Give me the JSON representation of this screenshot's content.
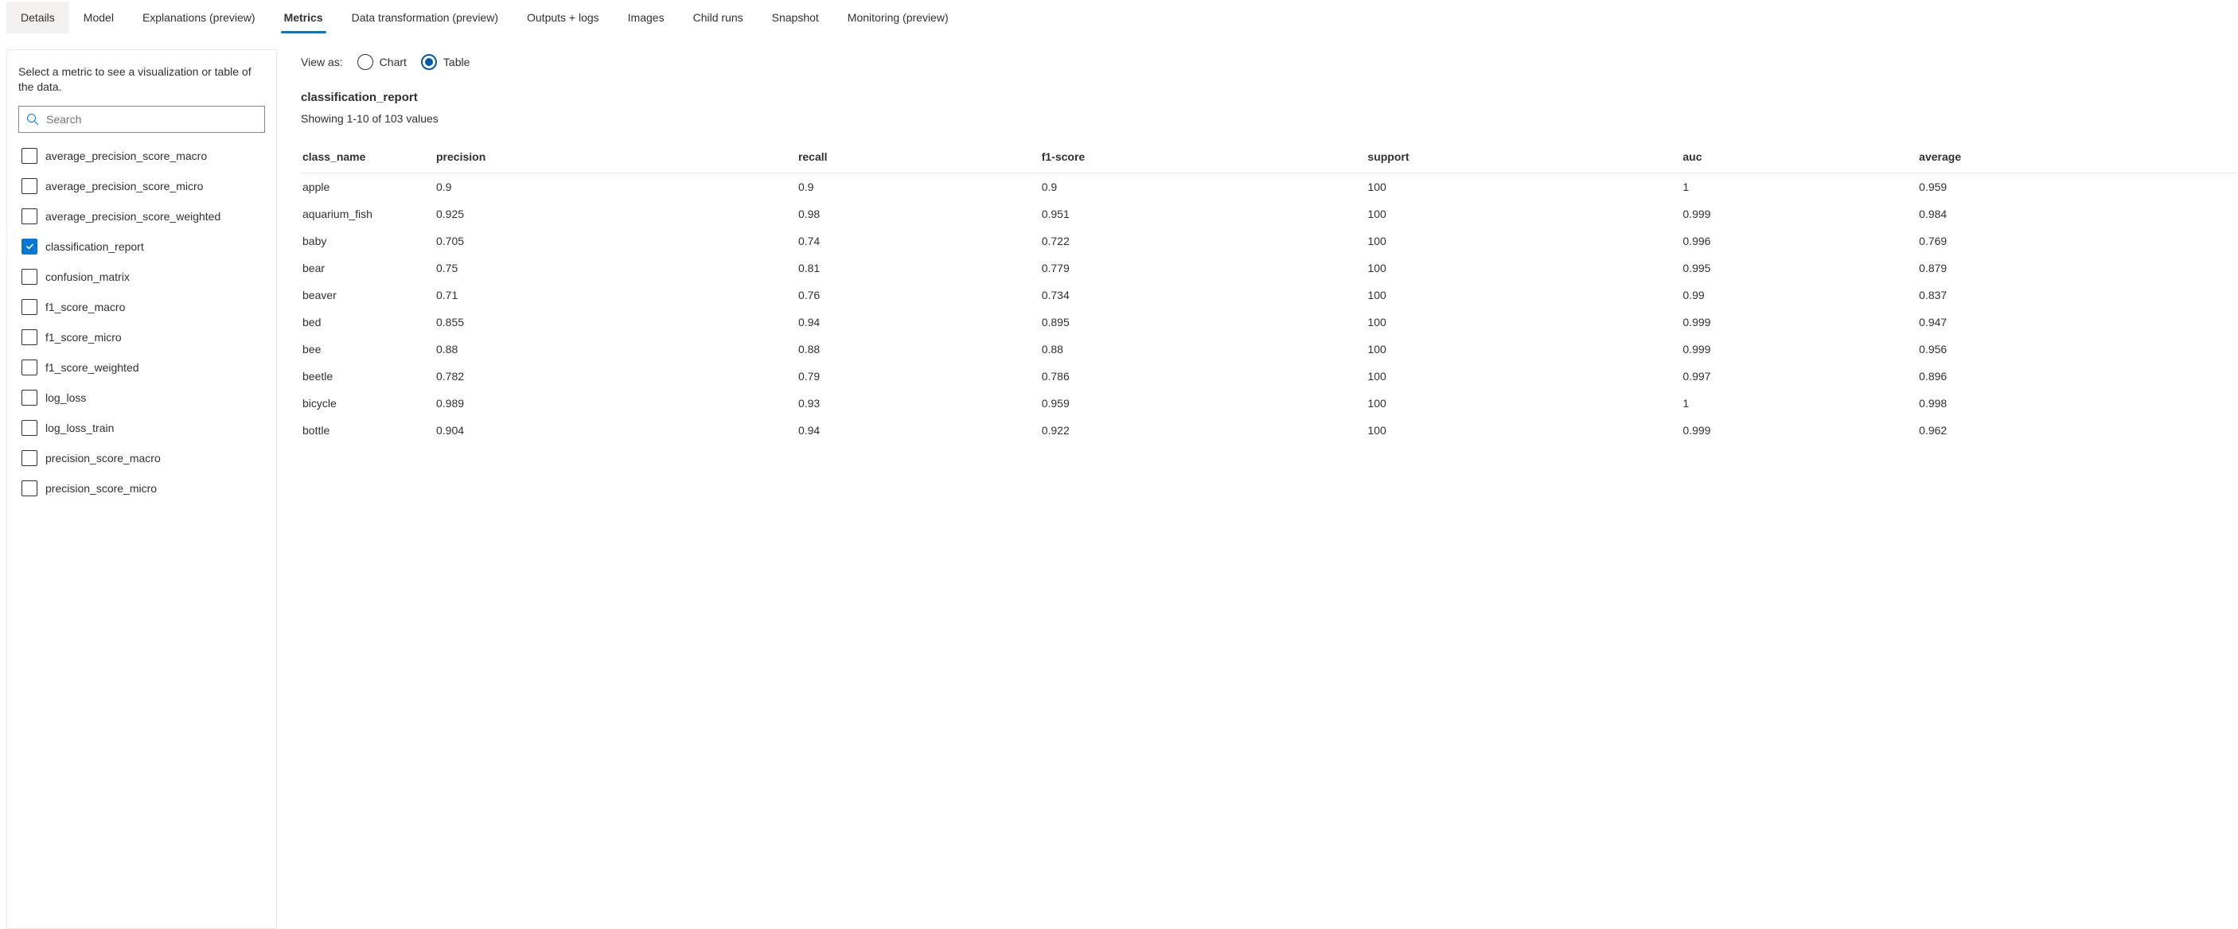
{
  "tabs": [
    {
      "label": "Details"
    },
    {
      "label": "Model"
    },
    {
      "label": "Explanations (preview)"
    },
    {
      "label": "Metrics"
    },
    {
      "label": "Data transformation (preview)"
    },
    {
      "label": "Outputs + logs"
    },
    {
      "label": "Images"
    },
    {
      "label": "Child runs"
    },
    {
      "label": "Snapshot"
    },
    {
      "label": "Monitoring (preview)"
    }
  ],
  "active_tab_index": 3,
  "sidebar": {
    "description": "Select a metric to see a visualization or table of the data.",
    "search_placeholder": "Search",
    "metrics": [
      {
        "label": "average_precision_score_macro",
        "checked": false
      },
      {
        "label": "average_precision_score_micro",
        "checked": false
      },
      {
        "label": "average_precision_score_weighted",
        "checked": false
      },
      {
        "label": "classification_report",
        "checked": true
      },
      {
        "label": "confusion_matrix",
        "checked": false
      },
      {
        "label": "f1_score_macro",
        "checked": false
      },
      {
        "label": "f1_score_micro",
        "checked": false
      },
      {
        "label": "f1_score_weighted",
        "checked": false
      },
      {
        "label": "log_loss",
        "checked": false
      },
      {
        "label": "log_loss_train",
        "checked": false
      },
      {
        "label": "precision_score_macro",
        "checked": false
      },
      {
        "label": "precision_score_micro",
        "checked": false
      }
    ]
  },
  "main": {
    "view_as_label": "View as:",
    "view_options": {
      "chart": "Chart",
      "table": "Table"
    },
    "view_selected": "table",
    "report_title": "classification_report",
    "report_subtitle": "Showing 1-10 of 103 values",
    "columns": [
      "class_name",
      "precision",
      "recall",
      "f1-score",
      "support",
      "auc",
      "average"
    ],
    "rows": [
      {
        "class_name": "apple",
        "precision": "0.9",
        "recall": "0.9",
        "f1": "0.9",
        "support": "100",
        "auc": "1",
        "avg": "0.959"
      },
      {
        "class_name": "aquarium_fish",
        "precision": "0.925",
        "recall": "0.98",
        "f1": "0.951",
        "support": "100",
        "auc": "0.999",
        "avg": "0.984"
      },
      {
        "class_name": "baby",
        "precision": "0.705",
        "recall": "0.74",
        "f1": "0.722",
        "support": "100",
        "auc": "0.996",
        "avg": "0.769"
      },
      {
        "class_name": "bear",
        "precision": "0.75",
        "recall": "0.81",
        "f1": "0.779",
        "support": "100",
        "auc": "0.995",
        "avg": "0.879"
      },
      {
        "class_name": "beaver",
        "precision": "0.71",
        "recall": "0.76",
        "f1": "0.734",
        "support": "100",
        "auc": "0.99",
        "avg": "0.837"
      },
      {
        "class_name": "bed",
        "precision": "0.855",
        "recall": "0.94",
        "f1": "0.895",
        "support": "100",
        "auc": "0.999",
        "avg": "0.947"
      },
      {
        "class_name": "bee",
        "precision": "0.88",
        "recall": "0.88",
        "f1": "0.88",
        "support": "100",
        "auc": "0.999",
        "avg": "0.956"
      },
      {
        "class_name": "beetle",
        "precision": "0.782",
        "recall": "0.79",
        "f1": "0.786",
        "support": "100",
        "auc": "0.997",
        "avg": "0.896"
      },
      {
        "class_name": "bicycle",
        "precision": "0.989",
        "recall": "0.93",
        "f1": "0.959",
        "support": "100",
        "auc": "1",
        "avg": "0.998"
      },
      {
        "class_name": "bottle",
        "precision": "0.904",
        "recall": "0.94",
        "f1": "0.922",
        "support": "100",
        "auc": "0.999",
        "avg": "0.962"
      }
    ]
  }
}
